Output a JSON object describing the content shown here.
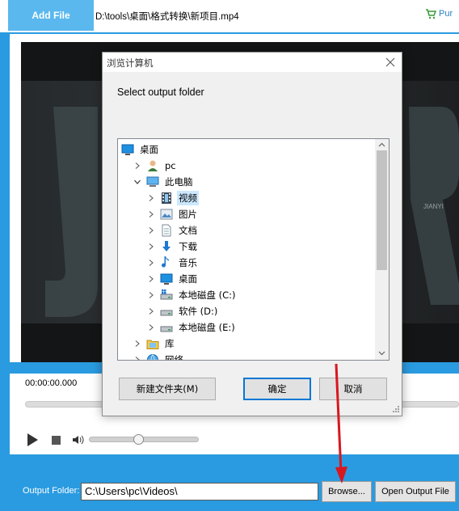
{
  "app": {
    "add_file_label": "Add File",
    "file_path": "D:\\tools\\桌面\\格式转换\\新项目.mp4",
    "purchase_label": "Pur",
    "timecode": "00:00:00.000",
    "volume_level": 0.45,
    "output_folder_label": "Output Folder:",
    "output_folder_value": "C:\\Users\\pc\\Videos\\",
    "browse_label": "Browse...",
    "open_output_label": "Open Output File",
    "video_overlay_text": "JIANYI"
  },
  "dialog": {
    "title": "浏览计算机",
    "prompt": "Select output folder",
    "tree": [
      {
        "label": "桌面",
        "icon": "desktop-icon",
        "expander": "none",
        "level": 0
      },
      {
        "label": "pc",
        "icon": "user-icon",
        "expander": "collapsed",
        "level": 1
      },
      {
        "label": "此电脑",
        "icon": "computer-icon",
        "expander": "expanded",
        "level": 1
      },
      {
        "label": "视频",
        "icon": "video-icon",
        "expander": "collapsed",
        "level": 2,
        "selected": true
      },
      {
        "label": "图片",
        "icon": "pictures-icon",
        "expander": "collapsed",
        "level": 2
      },
      {
        "label": "文档",
        "icon": "documents-icon",
        "expander": "collapsed",
        "level": 2
      },
      {
        "label": "下载",
        "icon": "download-icon",
        "expander": "collapsed",
        "level": 2
      },
      {
        "label": "音乐",
        "icon": "music-icon",
        "expander": "collapsed",
        "level": 2
      },
      {
        "label": "桌面",
        "icon": "desktop-icon",
        "expander": "collapsed",
        "level": 2
      },
      {
        "label": "本地磁盘 (C:)",
        "icon": "system-drive-icon",
        "expander": "collapsed",
        "level": 2
      },
      {
        "label": "软件 (D:)",
        "icon": "drive-icon",
        "expander": "collapsed",
        "level": 2
      },
      {
        "label": "本地磁盘 (E:)",
        "icon": "drive-icon",
        "expander": "collapsed",
        "level": 2
      },
      {
        "label": "库",
        "icon": "library-icon",
        "expander": "collapsed",
        "level": 1
      },
      {
        "label": "网络",
        "icon": "network-icon",
        "expander": "collapsed",
        "level": 1
      }
    ],
    "new_folder_label": "新建文件夹(M)",
    "ok_label": "确定",
    "cancel_label": "取消"
  },
  "colors": {
    "app_background": "#2a9be0",
    "add_file_button": "#5ab8ee",
    "selection": "#cce8ff",
    "default_button_border": "#0078d7",
    "annotation_arrow": "#d9171e"
  }
}
